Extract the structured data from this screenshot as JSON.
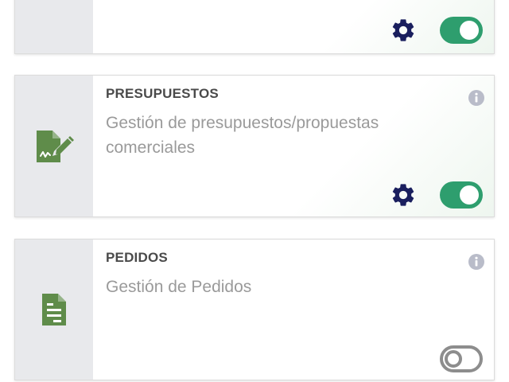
{
  "modules": [
    {
      "title": "",
      "description": "",
      "icon": "module-icon",
      "enabled": true,
      "has_settings": true
    },
    {
      "title": "PRESUPUESTOS",
      "description": "Gestión de presupuestos/propuestas comerciales",
      "icon": "signed-document-icon",
      "enabled": true,
      "has_settings": true
    },
    {
      "title": "PEDIDOS",
      "description": "Gestión de Pedidos",
      "icon": "order-document-icon",
      "enabled": false,
      "has_settings": false
    }
  ],
  "colors": {
    "toggle_on": "#2e9e6e",
    "toggle_off": "#8d8d8d",
    "gear": "#1a1f5e",
    "module_icon": "#5f8c4a",
    "info_icon": "#b9bcc9"
  }
}
